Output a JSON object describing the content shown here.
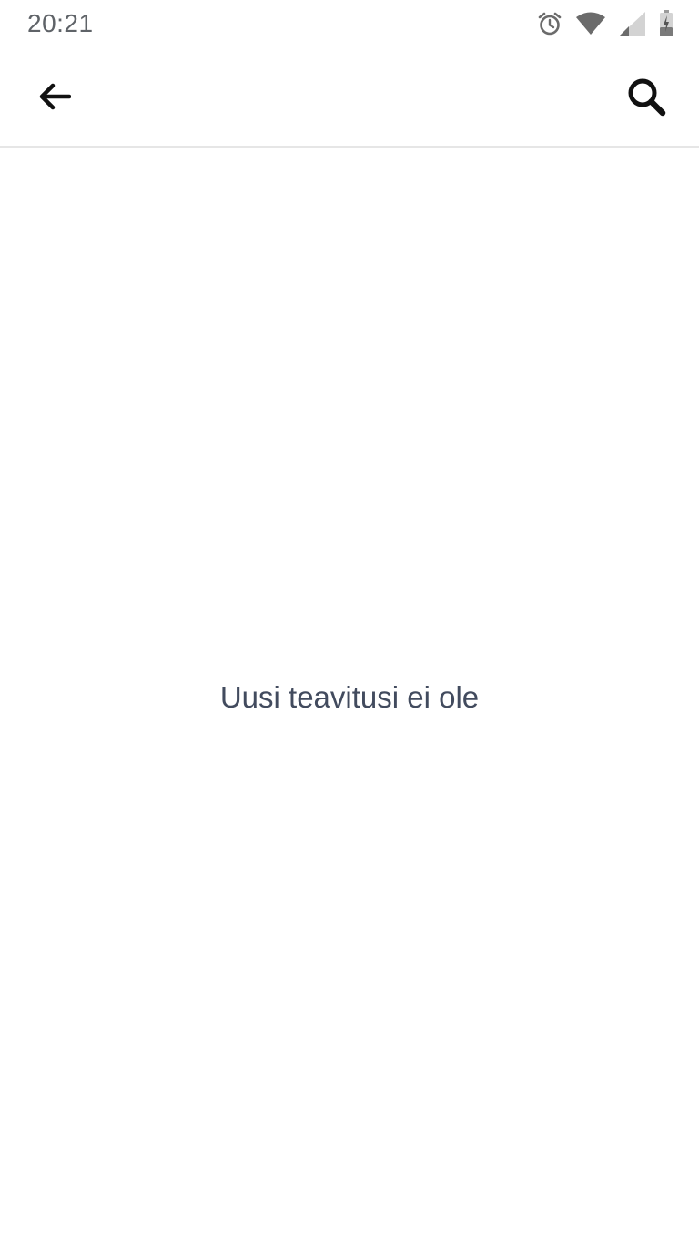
{
  "status_bar": {
    "time": "20:21",
    "icons": [
      "alarm-icon",
      "wifi-icon",
      "cell-signal-icon",
      "battery-charging-icon"
    ]
  },
  "app_bar": {
    "back_icon": "arrow-left-icon",
    "search_icon": "search-icon"
  },
  "main": {
    "empty_message": "Uusi teavitusi ei ole"
  },
  "colors": {
    "status_text": "#5f6368",
    "icon": "#111111",
    "message_text": "#424b5e",
    "divider": "#e6e6e6",
    "background": "#ffffff"
  }
}
